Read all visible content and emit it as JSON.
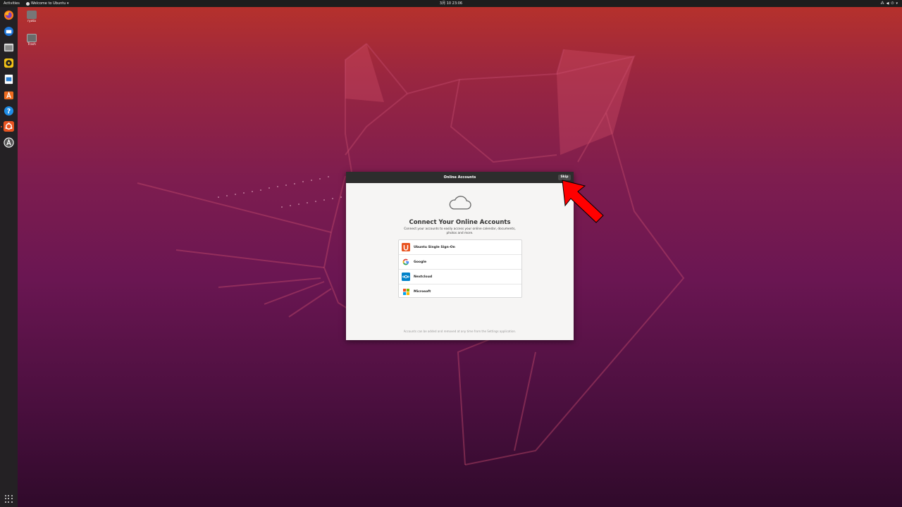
{
  "topbar": {
    "activities": "Activities",
    "app_menu": "Welcome to Ubuntu ▾",
    "clock": "3月 10  23:06",
    "tray_icons": [
      "network-icon",
      "volume-icon",
      "power-icon"
    ]
  },
  "dock": {
    "items": [
      "firefox",
      "thunderbird",
      "files",
      "rhythmbox",
      "libreoffice-writer",
      "software",
      "help",
      "ubuntu-settings",
      "software-updater"
    ]
  },
  "desktop": {
    "home_label": "ryota",
    "trash_label": "Trash"
  },
  "dialog": {
    "title": "Online Accounts",
    "skip_label": "Skip",
    "heading": "Connect Your Online Accounts",
    "subtitle": "Connect your accounts to easily access your online calendar, documents, photos and more.",
    "accounts": [
      {
        "label": "Ubuntu Single Sign-On",
        "icon": "ubuntu-sso-icon"
      },
      {
        "label": "Google",
        "icon": "google-icon"
      },
      {
        "label": "Nextcloud",
        "icon": "nextcloud-icon"
      },
      {
        "label": "Microsoft",
        "icon": "microsoft-icon"
      }
    ],
    "footer": "Accounts can be added and removed at any time from the Settings application."
  },
  "colors": {
    "ubuntu_orange": "#e95420",
    "annotation_arrow": "#ff0000"
  }
}
